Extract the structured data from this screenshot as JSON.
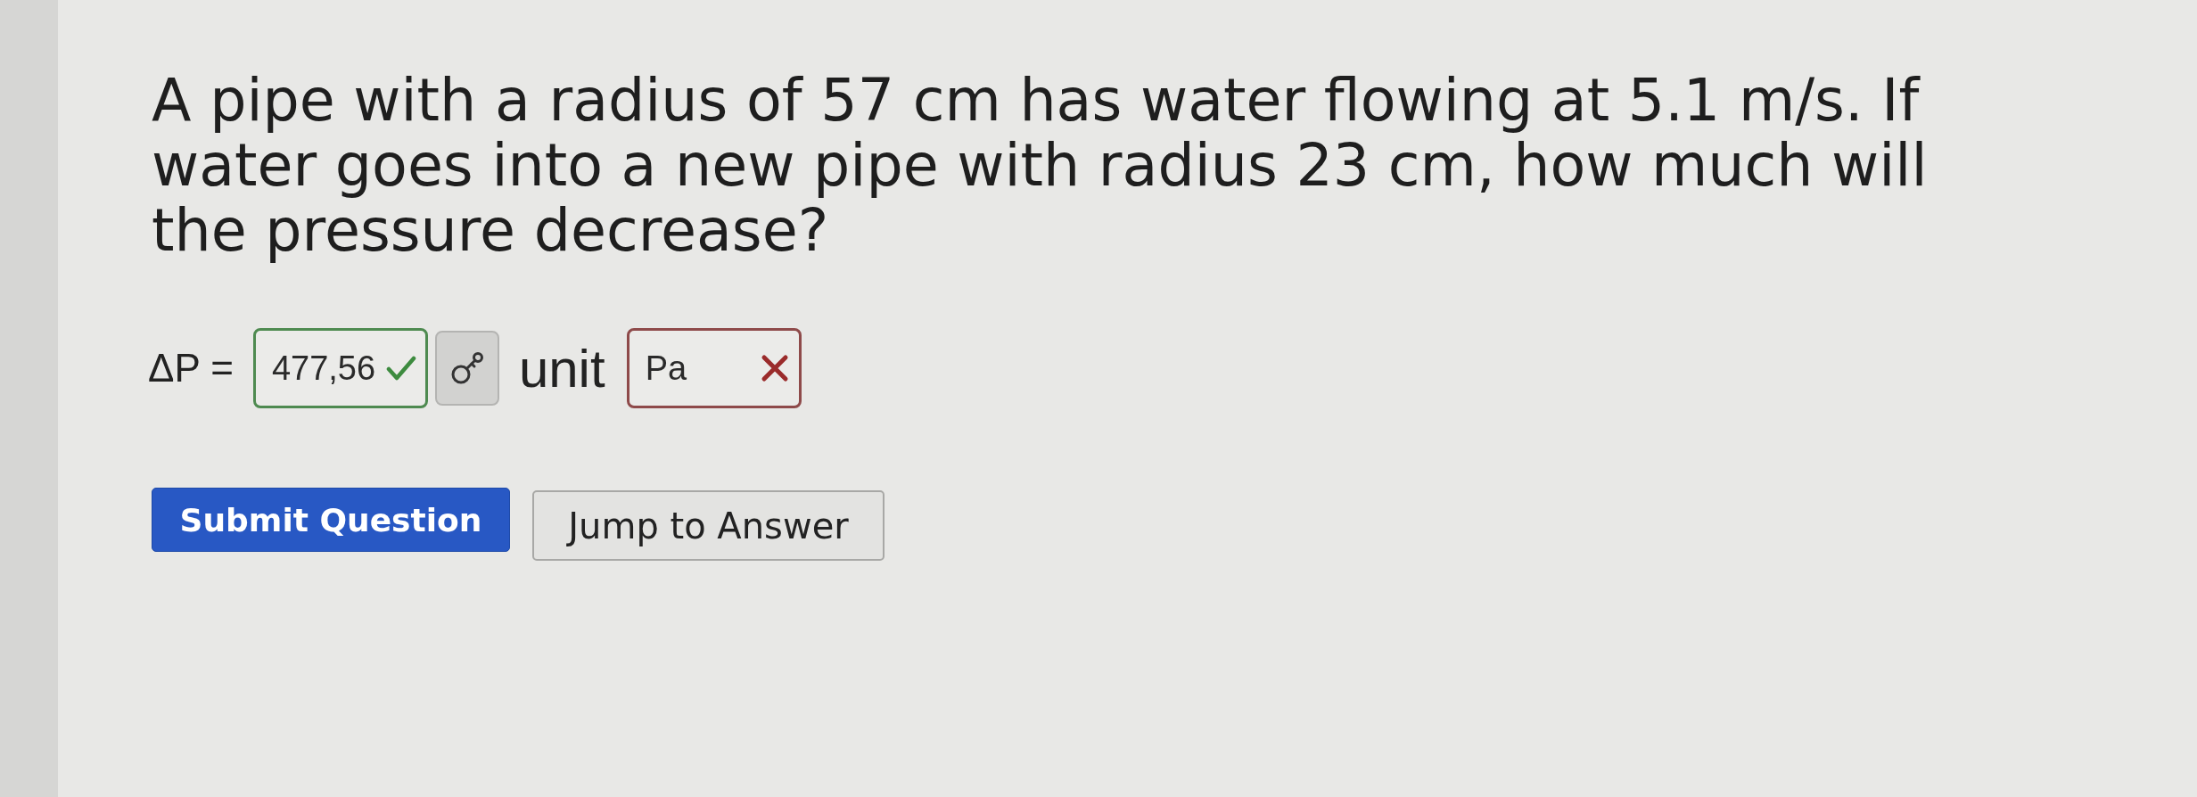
{
  "question": {
    "text": "A pipe with a radius of 57 cm has water flowing at 5.1 m/s. If water goes into a new pipe with radius 23 cm, how much will the pressure decrease?"
  },
  "answer_row": {
    "label": "ΔP =",
    "value_field": {
      "value": "477,56",
      "correct": true
    },
    "unit_label": "unit",
    "unit_field": {
      "value": "Pa",
      "correct": false
    }
  },
  "buttons": [
    {
      "label": "Submit Question",
      "kind": "primary"
    },
    {
      "label": "Jump to Answer",
      "kind": "secondary"
    }
  ]
}
